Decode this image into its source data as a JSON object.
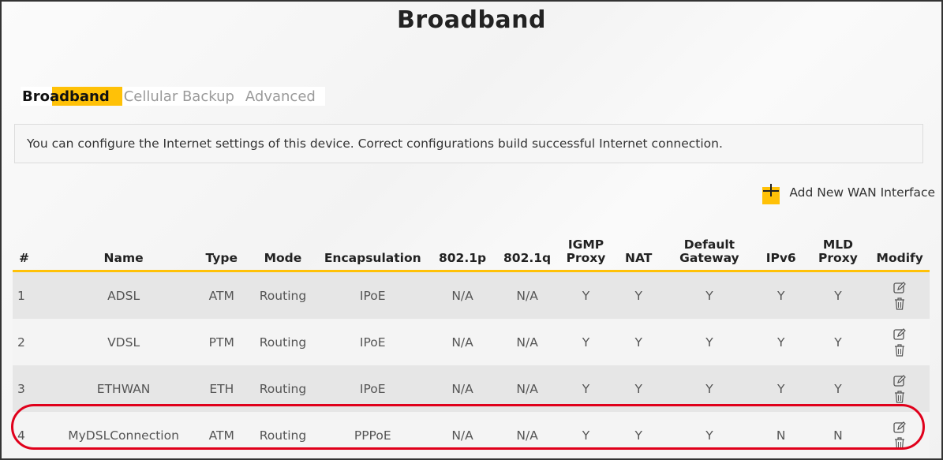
{
  "page": {
    "title": "Broadband"
  },
  "tabs": [
    {
      "label": "Broadband",
      "active": true
    },
    {
      "label": "Cellular Backup",
      "active": false
    },
    {
      "label": "Advanced",
      "active": false
    }
  ],
  "info": {
    "text": "You can configure the Internet settings of this device. Correct configurations build successful Internet connection."
  },
  "add_wan": {
    "label": "Add New WAN Interface",
    "icon": "plus-icon"
  },
  "table": {
    "headers": [
      "#",
      "Name",
      "Type",
      "Mode",
      "Encapsulation",
      "802.1p",
      "802.1q",
      "IGMP Proxy",
      "NAT",
      "Default Gateway",
      "IPv6",
      "MLD Proxy",
      "Modify"
    ],
    "rows": [
      {
        "idx": "1",
        "name": "ADSL",
        "type": "ATM",
        "mode": "Routing",
        "encap": "IPoE",
        "p8021p": "N/A",
        "p8021q": "N/A",
        "igmp": "Y",
        "nat": "Y",
        "gateway": "Y",
        "ipv6": "Y",
        "mld": "Y"
      },
      {
        "idx": "2",
        "name": "VDSL",
        "type": "PTM",
        "mode": "Routing",
        "encap": "IPoE",
        "p8021p": "N/A",
        "p8021q": "N/A",
        "igmp": "Y",
        "nat": "Y",
        "gateway": "Y",
        "ipv6": "Y",
        "mld": "Y"
      },
      {
        "idx": "3",
        "name": "ETHWAN",
        "type": "ETH",
        "mode": "Routing",
        "encap": "IPoE",
        "p8021p": "N/A",
        "p8021q": "N/A",
        "igmp": "Y",
        "nat": "Y",
        "gateway": "Y",
        "ipv6": "Y",
        "mld": "Y"
      },
      {
        "idx": "4",
        "name": "MyDSLConnection",
        "type": "ATM",
        "mode": "Routing",
        "encap": "PPPoE",
        "p8021p": "N/A",
        "p8021q": "N/A",
        "igmp": "Y",
        "nat": "Y",
        "gateway": "Y",
        "ipv6": "N",
        "mld": "N"
      }
    ]
  },
  "colors": {
    "accent": "#ffc107",
    "highlight": "#e0001b"
  }
}
